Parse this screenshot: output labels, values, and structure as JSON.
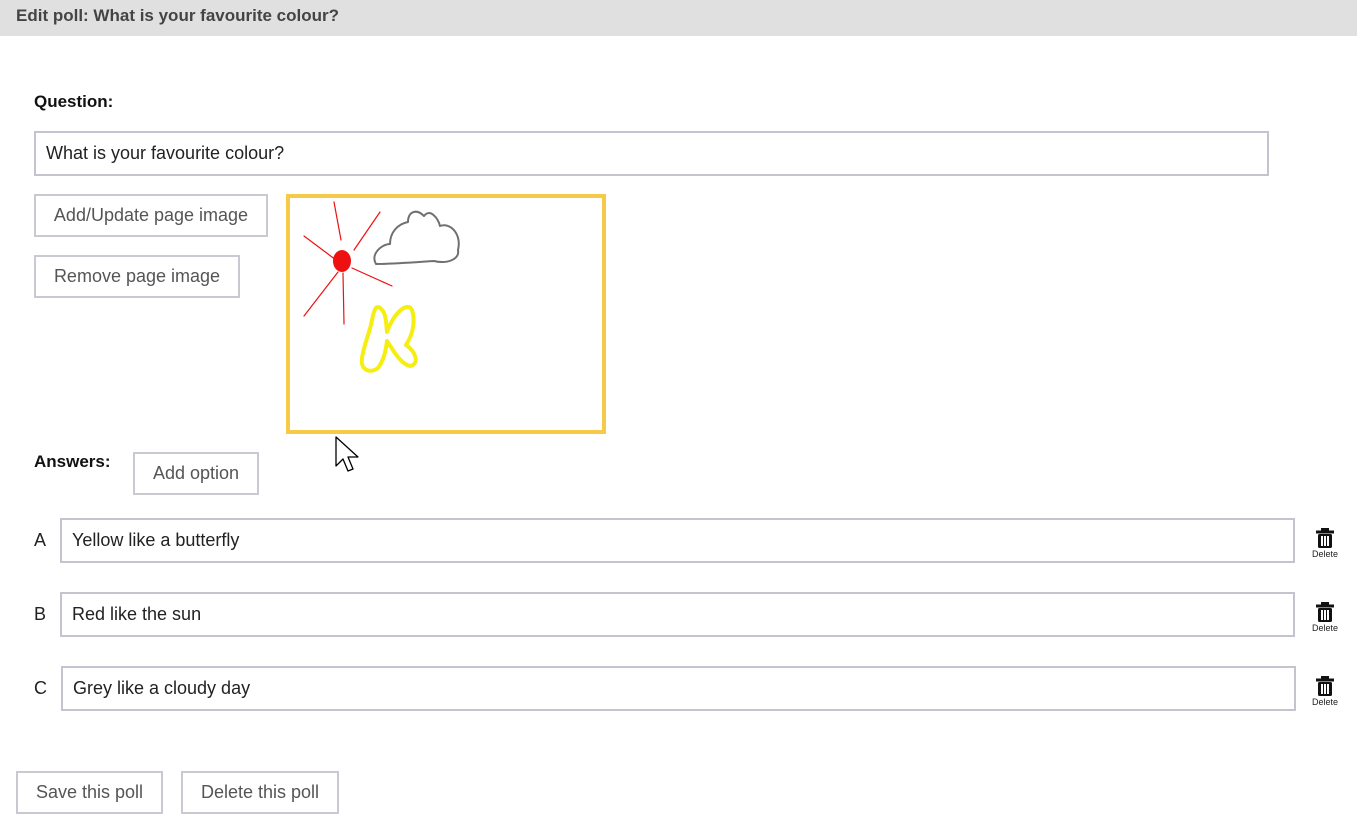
{
  "header": {
    "title": "Edit poll: What is your favourite colour?"
  },
  "question": {
    "label": "Question:",
    "value": "What is your favourite colour?"
  },
  "image_controls": {
    "add_update_label": "Add/Update page image",
    "remove_label": "Remove page image",
    "colors": {
      "frame": "#f7c948",
      "sun": "#ee1111",
      "cloud": "#707070",
      "butterfly": "#f5ee10"
    }
  },
  "answers": {
    "label": "Answers:",
    "add_option_label": "Add option",
    "delete_label": "Delete",
    "items": [
      {
        "letter": "A",
        "value": "Yellow like a butterfly"
      },
      {
        "letter": "B",
        "value": "Red like the sun"
      },
      {
        "letter": "C",
        "value": "Grey like a cloudy day"
      }
    ]
  },
  "footer": {
    "save_label": "Save this poll",
    "delete_poll_label": "Delete this poll"
  }
}
